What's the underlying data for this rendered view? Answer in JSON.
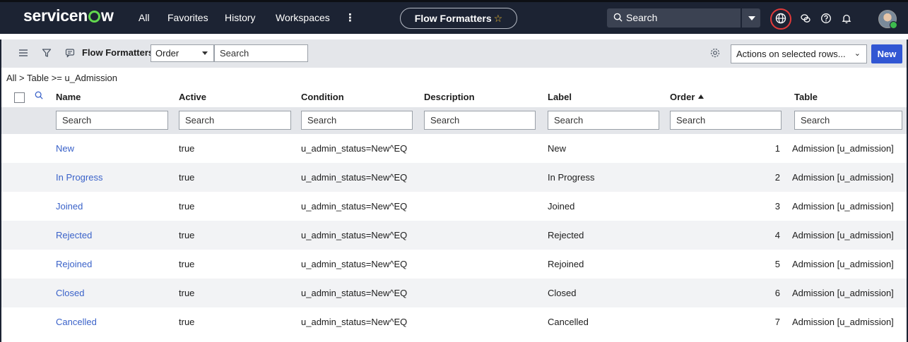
{
  "topnav": {
    "logo": "servicenow",
    "links": [
      "All",
      "Favorites",
      "History",
      "Workspaces"
    ],
    "more_label": "⋮",
    "current_page": "Flow Formatters",
    "search_placeholder": "Search",
    "icons": [
      "globe-icon",
      "chat-icon",
      "help-icon",
      "bell-icon",
      "avatar"
    ]
  },
  "toolbar": {
    "title": "Flow Formatters",
    "field_select": "Order",
    "search_placeholder": "Search",
    "actions_select": "Actions on selected rows...",
    "new_label": "New"
  },
  "breadcrumb": "All > Table >= u_Admission",
  "table": {
    "columns": [
      "Name",
      "Active",
      "Condition",
      "Description",
      "Label",
      "Order",
      "Table"
    ],
    "sorted_column": "Order",
    "filter_placeholder": "Search",
    "rows": [
      {
        "name": "New",
        "active": "true",
        "condition": "u_admin_status=New^EQ",
        "description": "",
        "label": "New",
        "order": "1",
        "table": "Admission [u_admission]"
      },
      {
        "name": "In Progress",
        "active": "true",
        "condition": "u_admin_status=New^EQ",
        "description": "",
        "label": "In Progress",
        "order": "2",
        "table": "Admission [u_admission]"
      },
      {
        "name": "Joined",
        "active": "true",
        "condition": "u_admin_status=New^EQ",
        "description": "",
        "label": "Joined",
        "order": "3",
        "table": "Admission [u_admission]"
      },
      {
        "name": "Rejected",
        "active": "true",
        "condition": "u_admin_status=New^EQ",
        "description": "",
        "label": "Rejected",
        "order": "4",
        "table": "Admission [u_admission]"
      },
      {
        "name": "Rejoined",
        "active": "true",
        "condition": "u_admin_status=New^EQ",
        "description": "",
        "label": "Rejoined",
        "order": "5",
        "table": "Admission [u_admission]"
      },
      {
        "name": "Closed",
        "active": "true",
        "condition": "u_admin_status=New^EQ",
        "description": "",
        "label": "Closed",
        "order": "6",
        "table": "Admission [u_admission]"
      },
      {
        "name": "Cancelled",
        "active": "true",
        "condition": "u_admin_status=New^EQ",
        "description": "",
        "label": "Cancelled",
        "order": "7",
        "table": "Admission [u_admission]"
      }
    ]
  },
  "colors": {
    "nav_bg": "#1c2333",
    "toolbar_bg": "#e4e6ea",
    "link": "#3a62c9",
    "primary_button": "#3156d3",
    "highlight_ring": "#e23a3a"
  }
}
